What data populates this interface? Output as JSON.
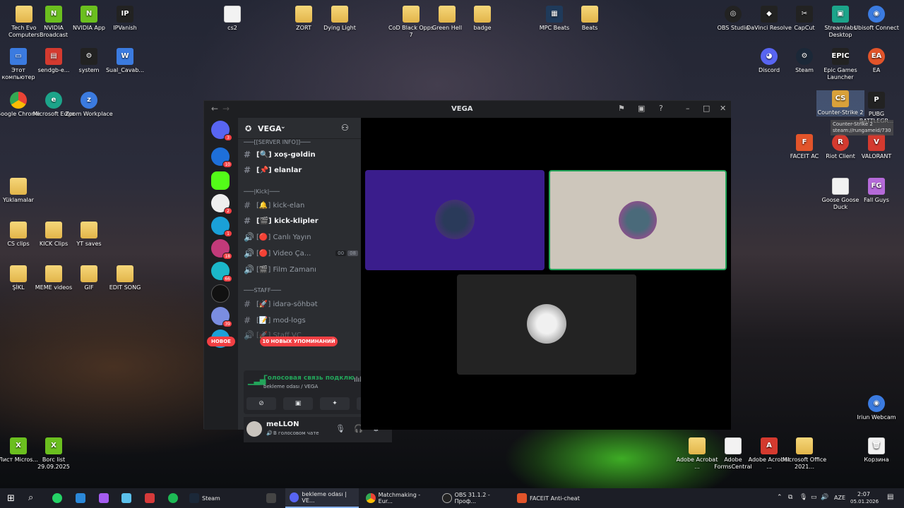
{
  "desktop": {
    "icons_left": [
      "Tech Evo Computers",
      "NVIDIA Broadcast",
      "NVIDIA App",
      "IPVanish",
      "Этот компьютер",
      "sendgb-e...",
      "system",
      "Sual_Cavab...",
      "Google Chrome",
      "Microsoft Edge",
      "Zoom Workplace",
      "Yüklamalar",
      "CS clips",
      "KICK Clips",
      "YT saves",
      "ŞİKL",
      "MEME videos",
      "GIF",
      "EDIT SONG"
    ],
    "icons_top": [
      "cs2",
      "ZORT",
      "Dying Light",
      "CoD Black Opps 7",
      "Green Hell",
      "badge",
      "MPC Beats",
      "Beats"
    ],
    "icons_right": [
      "OBS Studio",
      "DaVinci Resolve",
      "CapCut",
      "Streamlabs Desktop",
      "Ubisoft Connect",
      "Discord",
      "Steam",
      "Epic Games Launcher",
      "EA",
      "Counter-Strike 2",
      "PUBG BATTLEGR...",
      "FACEIT AC",
      "Riot Client",
      "VALORANT",
      "Goose Goose Duck",
      "Fall Guys",
      "Iriun Webcam",
      "Adobe Acrobat ...",
      "Adobe FormsCentral",
      "Adobe Acrobat ...",
      "Microsoft Office 2021...",
      "Корзина"
    ],
    "icons_bottom_left": [
      "Лист Micros...",
      "Borc list 29.09.2025"
    ]
  },
  "discord": {
    "window_title": "VEGA",
    "server_name": "VEGA",
    "guild_badges": [
      "3",
      "10",
      "2",
      "1",
      "18",
      "66",
      "39"
    ],
    "categories": [
      "[SERVER INFO]",
      "|Kick|",
      "STAFF"
    ],
    "channels": [
      {
        "name": "xoş-gəldin",
        "prefix": "#",
        "tag": "[🔍]",
        "unread": true
      },
      {
        "name": "elanlar",
        "prefix": "#",
        "tag": "[📌]",
        "unread": true
      },
      {
        "name": "kick-elan",
        "prefix": "#",
        "tag": "[🔔]",
        "unread": false
      },
      {
        "name": "kick-klipler",
        "prefix": "#",
        "tag": "[🎬]",
        "unread": true
      },
      {
        "name": "Canlı Yayın",
        "prefix": "🔊",
        "tag": "[🔴]",
        "unread": false
      },
      {
        "name": "Video Ça...",
        "prefix": "🔊",
        "tag": "[🔴]",
        "unread": false,
        "counts": [
          "00",
          "08"
        ]
      },
      {
        "name": "Film Zamanı",
        "prefix": "🔊",
        "tag": "[🎬]",
        "unread": false
      },
      {
        "name": "idarə-söhbət",
        "prefix": "#",
        "tag": "[🚀]",
        "unread": false
      },
      {
        "name": "mod-logs",
        "prefix": "#",
        "tag": "[📝]",
        "unread": false
      },
      {
        "name": "Staff VC",
        "prefix": "🔊",
        "tag": "[🚀]",
        "unread": false
      }
    ],
    "new_label": "НОВОЕ",
    "mentions_label": "10 НОВЫХ УПОМИНАНИЙ",
    "voice": {
      "status": "Голосовая связь подклю",
      "channel": "bekleme odası / VEGA"
    },
    "user": {
      "name": "meLLON",
      "status": "В голосовом чате"
    }
  },
  "taskbar": {
    "apps": [
      "Steam",
      "bekleme odası | VE...",
      "Matchmaking - Eur...",
      "OBS 31.1.2 - Проф...",
      "FACEIT Anti-cheat"
    ],
    "lang": "AZE",
    "time": "2:07",
    "date": "05.01.2026"
  },
  "tooltip": {
    "line1": "Counter-Strike 2",
    "line2": "steam://rungameid/730"
  }
}
